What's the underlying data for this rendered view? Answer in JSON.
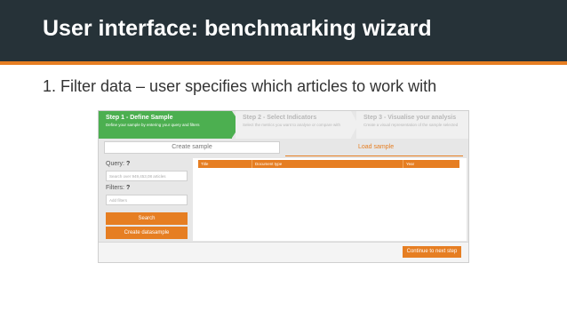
{
  "slide": {
    "title": "User interface: benchmarking wizard",
    "bullet": "1.  Filter data – user specifies which articles to work with"
  },
  "colors": {
    "header_bg": "#263238",
    "accent": "#e67e22",
    "step_active": "#4caf50"
  },
  "wizard": {
    "steps": [
      {
        "title": "Step 1 - Define Sample",
        "description": "Define your sample by entering your query and filters",
        "state": "active"
      },
      {
        "title": "Step 2 - Select Indicators",
        "description": "Select the metrics you want to analyse or compare with",
        "state": "inactive"
      },
      {
        "title": "Step 3 - Visualise your analysis",
        "description": "Create a visual representation of the sample selected",
        "state": "inactive"
      }
    ],
    "topbar": {
      "create_sample_label": "Create sample",
      "load_sample_label": "Load sample"
    },
    "sidebar": {
      "query_label": "Query:",
      "query_help": "?",
      "query_placeholder": "Search over 949,453,08 articles",
      "filters_label": "Filters:",
      "filters_help": "?",
      "filter_placeholder": "Add filters",
      "search_button": "Search",
      "create_datasample_button": "Create datasample"
    },
    "table": {
      "columns": [
        "Title",
        "Document type",
        "Year"
      ]
    },
    "footer": {
      "continue_button": "Continue to next step"
    }
  }
}
